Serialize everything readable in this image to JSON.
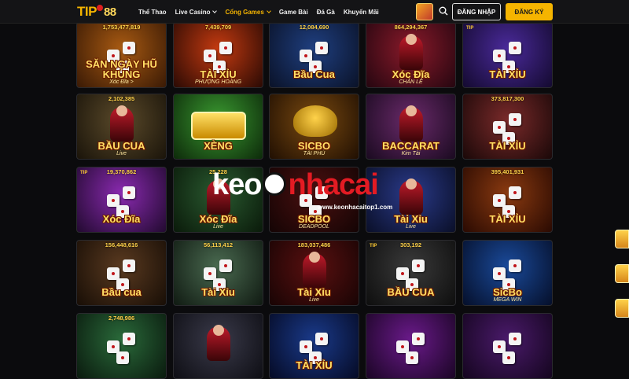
{
  "header": {
    "logo": {
      "part1": "TIP",
      "part2": "88"
    },
    "nav": [
      {
        "label": "Thể Thao",
        "dropdown": false,
        "active": false
      },
      {
        "label": "Live Casino",
        "dropdown": true,
        "active": false
      },
      {
        "label": "Cổng Games",
        "dropdown": true,
        "active": true
      },
      {
        "label": "Game Bài",
        "dropdown": false,
        "active": false
      },
      {
        "label": "Đá Gà",
        "dropdown": false,
        "active": false
      },
      {
        "label": "Khuyến Mãi",
        "dropdown": false,
        "active": false
      }
    ],
    "login_label": "ĐĂNG NHẬP",
    "register_label": "ĐĂNG KÝ"
  },
  "colors": {
    "accent": "#f5b400",
    "background": "#0b0b0d",
    "header_bg": "#141416"
  },
  "games": [
    {
      "jackpot": "1,753,477,819",
      "title": "SĂN NGÀY HŨ KHỦNG",
      "sub": "Xóc Đĩa >",
      "brand": ""
    },
    {
      "jackpot": "7,439,709",
      "title": "TÀI XỈU",
      "sub": "PHƯỢNG HOÀNG",
      "brand": ""
    },
    {
      "jackpot": "12,084,690",
      "title": "Bầu Cua",
      "sub": "",
      "brand": ""
    },
    {
      "jackpot": "864,294,367",
      "title": "Xóc Đĩa",
      "sub": "CHẴN   LẺ",
      "brand": ""
    },
    {
      "jackpot": "",
      "title": "TÀI XỈU",
      "sub": "",
      "brand": "TIP"
    },
    {
      "jackpot": "2,102,385",
      "title": "BẦU CUA",
      "sub": "Live",
      "brand": ""
    },
    {
      "jackpot": "",
      "title": "XÈNG",
      "sub": "",
      "brand": ""
    },
    {
      "jackpot": "",
      "title": "SICBO",
      "sub": "TÀI PHÚ",
      "brand": ""
    },
    {
      "jackpot": "",
      "title": "BACCARAT",
      "sub": "Kim Tài",
      "brand": ""
    },
    {
      "jackpot": "373,817,300",
      "title": "TÀI XỈU",
      "sub": "",
      "brand": ""
    },
    {
      "jackpot": "19,370,862",
      "title": "Xóc Đĩa",
      "sub": "",
      "brand": "TIP"
    },
    {
      "jackpot": "25,228",
      "title": "Xóc Đĩa",
      "sub": "Live",
      "brand": ""
    },
    {
      "jackpot": "",
      "title": "SICBO",
      "sub": "DEADPOOL",
      "brand": ""
    },
    {
      "jackpot": "",
      "title": "Tài Xỉu",
      "sub": "Live",
      "brand": ""
    },
    {
      "jackpot": "395,401,931",
      "title": "TÀI XỈU",
      "sub": "",
      "brand": ""
    },
    {
      "jackpot": "156,448,616",
      "title": "Bầu cua",
      "sub": "",
      "brand": ""
    },
    {
      "jackpot": "56,113,412",
      "title": "Tài Xỉu",
      "sub": "",
      "brand": ""
    },
    {
      "jackpot": "183,037,486",
      "title": "Tài Xỉu",
      "sub": "Live",
      "brand": ""
    },
    {
      "jackpot": "303,192",
      "title": "BẦU CUA",
      "sub": "",
      "brand": "TIP"
    },
    {
      "jackpot": "",
      "title": "SicBo",
      "sub": "MEGA WIN",
      "brand": ""
    },
    {
      "jackpot": "2,748,986",
      "title": "",
      "sub": "",
      "brand": ""
    },
    {
      "jackpot": "",
      "title": "",
      "sub": "",
      "brand": ""
    },
    {
      "jackpot": "",
      "title": "TÀI   XỈU",
      "sub": "",
      "brand": ""
    },
    {
      "jackpot": "",
      "title": "",
      "sub": "",
      "brand": ""
    },
    {
      "jackpot": "",
      "title": "",
      "sub": "",
      "brand": ""
    }
  ],
  "watermark": {
    "part1": "keo",
    "part2": "nhacai",
    "url": "www.keonhacaitop1.com"
  }
}
